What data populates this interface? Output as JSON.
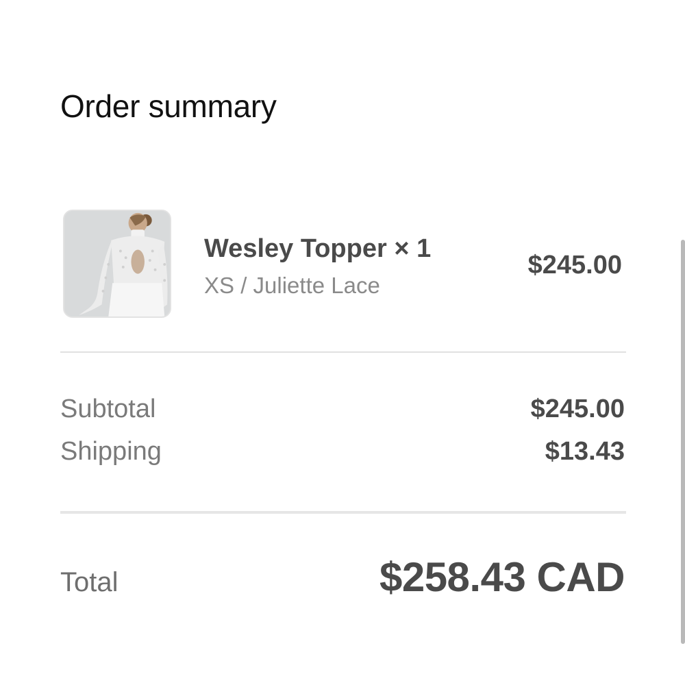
{
  "summary": {
    "title": "Order summary"
  },
  "line_item": {
    "image_icon": "product-thumbnail",
    "name": "Wesley Topper × 1",
    "variant": "XS / Juliette Lace",
    "price": "$245.00"
  },
  "totals": {
    "subtotal_label": "Subtotal",
    "subtotal_value": "$245.00",
    "shipping_label": "Shipping",
    "shipping_value": "$13.43",
    "total_label": "Total",
    "total_value": "$258.43 CAD"
  },
  "colors": {
    "background": "#ffffff",
    "title_text": "#111111",
    "primary_text": "#4a4a4a",
    "secondary_text": "#8a8a8a",
    "divider": "#e1e1e1"
  }
}
